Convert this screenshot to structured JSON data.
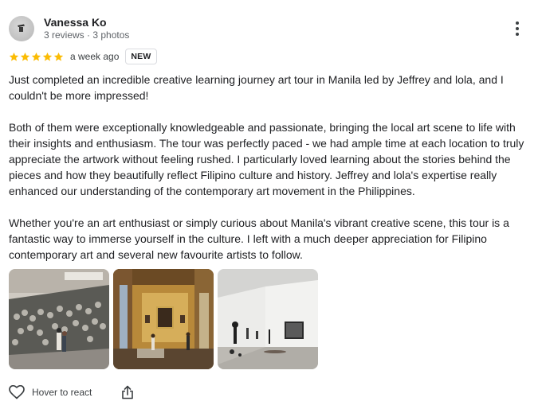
{
  "reviewer": {
    "name": "Vanessa Ko",
    "meta": "3 reviews · 3 photos",
    "avatar_icon": "user-avatar-icon"
  },
  "rating": {
    "stars": 5,
    "max_stars": 5,
    "star_color": "#fbbc04",
    "time": "a week ago",
    "badge": "NEW"
  },
  "review": {
    "paragraphs": [
      "Just completed an incredible creative learning journey art tour in Manila led by Jeffrey and lola, and I couldn't be more impressed!",
      "Both of them were exceptionally knowledgeable and passionate, bringing the local art scene to life with their insights and enthusiasm. The tour was perfectly paced - we had ample time at each location to truly appreciate the artwork without feeling rushed. I particularly loved learning about the stories behind the pieces and how they beautifully reflect Filipino culture and history. Jeffrey and lola's expertise really enhanced our understanding of the contemporary art movement in the Philippines.",
      "Whether you're an art enthusiast or simply curious about Manila's vibrant creative scene, this tour is a fantastic way to immerse yourself in the culture. I left with a much deeper appreciation for Filipino contemporary art and several new favourite artists to follow."
    ]
  },
  "photos": [
    {
      "icon": "gallery-mural-photo"
    },
    {
      "icon": "gallery-yellow-room-photo"
    },
    {
      "icon": "gallery-white-room-photo"
    }
  ],
  "actions": {
    "react_label": "Hover to react",
    "react_icon": "heart-icon",
    "share_icon": "share-icon"
  },
  "colors": {
    "text_primary": "#202124",
    "text_secondary": "#5f6368",
    "star": "#fbbc04",
    "border": "#dadce0"
  }
}
